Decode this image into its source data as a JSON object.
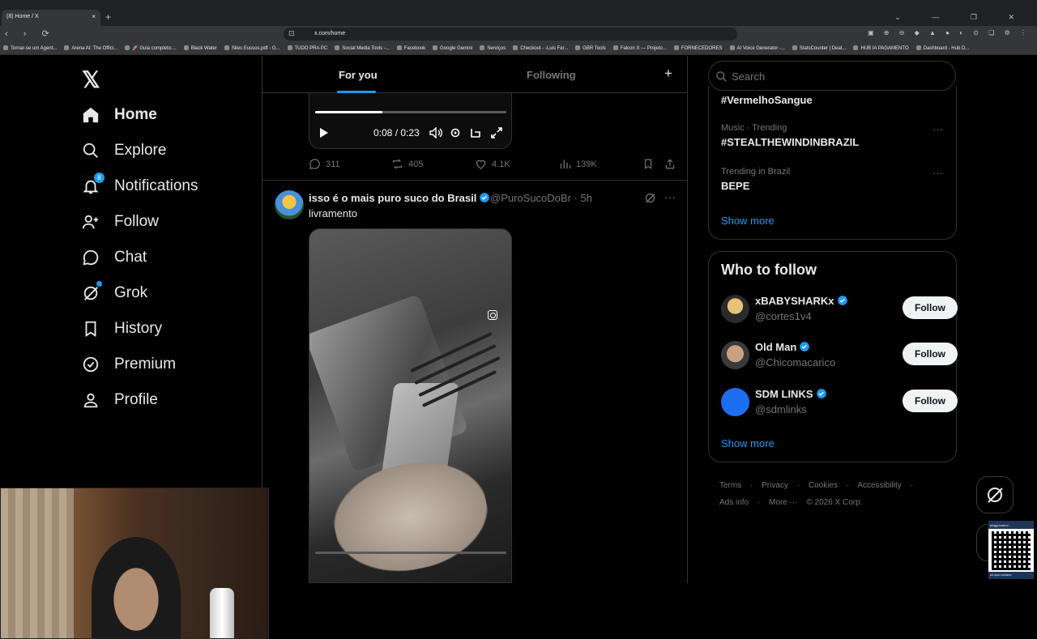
{
  "browser": {
    "tab_title": "(8) Home / X",
    "tab_close": "×",
    "new_tab": "+",
    "window_controls": "⌄ — ❐ ✕",
    "url": "x.com/home",
    "nav_buttons": "‹ › ⟳",
    "bookmarks": [
      "Tornar-se um Agent...",
      "Arena AI: The Offici...",
      "🚀 Guia completo:...",
      "Black Water",
      "Sites Eussos.pdf - G...",
      "TUDO PRA PC",
      "Social Media Tools -...",
      "Facebook",
      "Google Gemini",
      "Serviços",
      "Checkout - -Luis Fer...",
      "GBR Tools",
      "Falcon X — Projeto...",
      "FORNECEDORES",
      "AI Voice Generator -...",
      "StatsCounter | Deat...",
      "HUB IA PAGAMENTO",
      "Dashboard - Hub D..."
    ]
  },
  "sidebar": {
    "items": [
      {
        "label": "Home",
        "icon": "home-icon"
      },
      {
        "label": "Explore",
        "icon": "search-icon"
      },
      {
        "label": "Notifications",
        "icon": "bell-icon",
        "badge": "8"
      },
      {
        "label": "Follow",
        "icon": "person-plus-icon"
      },
      {
        "label": "Chat",
        "icon": "chat-bubble-icon"
      },
      {
        "label": "Grok",
        "icon": "grok-icon"
      },
      {
        "label": "History",
        "icon": "bookmark-icon"
      },
      {
        "label": "Premium",
        "icon": "verified-badge-icon"
      },
      {
        "label": "Profile",
        "icon": "person-icon"
      }
    ]
  },
  "feed": {
    "tabs": {
      "for_you": "For you",
      "following": "Following"
    },
    "post1": {
      "time": "0:08 / 0:23",
      "progress": 0.35,
      "replies": "311",
      "reposts": "405",
      "likes": "4.1K",
      "views": "139K"
    },
    "post2": {
      "name": "isso é o mais puro suco do Brasil",
      "handle": "@PuroSucoDoBr · 5h",
      "text": "livramento",
      "more": "···"
    }
  },
  "right": {
    "search_placeholder": "Search",
    "top_trend": "#VermelhoSangue",
    "trends": [
      {
        "context": "Music · Trending",
        "name": "#STEALTHEWINDINBRAZIL"
      },
      {
        "context": "Trending in Brazil",
        "name": "BEPE"
      }
    ],
    "show_more": "Show more",
    "who_to_follow": {
      "title": "Who to follow",
      "accounts": [
        {
          "name": "xBABYSHARKx",
          "handle": "@cortes1v4",
          "button": "Follow"
        },
        {
          "name": "Old Man",
          "handle": "@Chicomacarico",
          "button": "Follow"
        },
        {
          "name": "SDM LINKS",
          "handle": "@sdmlinks",
          "button": "Follow"
        }
      ],
      "show_more": "Show more"
    },
    "footer": {
      "links_line1": [
        "Terms",
        "·",
        "Privacy",
        "·",
        "Cookies",
        "·",
        "Accessibility",
        "·"
      ],
      "links_line2": [
        "Ads info",
        "·",
        "More ···",
        "© 2026 X Corp."
      ]
    }
  },
  "overlay": {
    "qr_top": "pixgg.com/u/...",
    "qr_bottom": "DÁ AQUI A MOEDA"
  }
}
